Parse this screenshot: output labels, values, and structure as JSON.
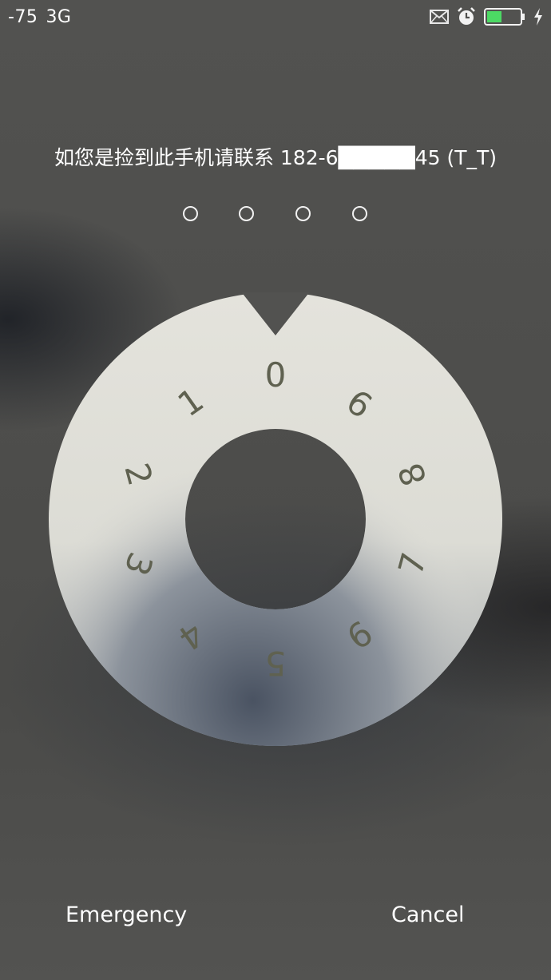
{
  "status_bar": {
    "signal": "-75",
    "network": "3G",
    "icons": [
      "mail-icon",
      "alarm-icon",
      "battery-icon",
      "charging-icon"
    ],
    "battery_color": "#4cd964"
  },
  "lock": {
    "message": "如您是捡到此手机请联系 182-6█████45 (T_T)",
    "pin_length": 4,
    "pin_entered": 0
  },
  "dial": {
    "digits": [
      "0",
      "9",
      "8",
      "7",
      "6",
      "5",
      "4",
      "3",
      "2",
      "1"
    ],
    "face_color": "#e2e1da"
  },
  "buttons": {
    "emergency": "Emergency",
    "cancel": "Cancel"
  }
}
